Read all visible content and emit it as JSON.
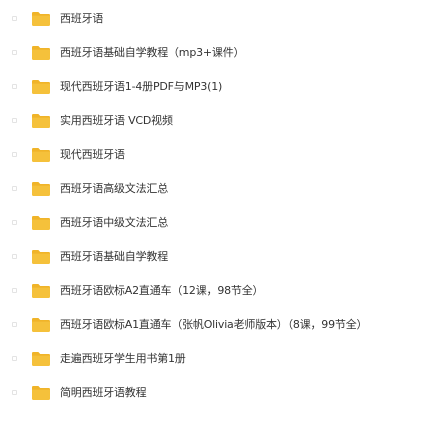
{
  "folder_color": "#f5c13b",
  "folder_tab_color": "#f0b429",
  "icon": "folder-icon",
  "items": [
    {
      "name": "西班牙语"
    },
    {
      "name": "西班牙语基础自学教程（mp3+课件）"
    },
    {
      "name": "现代西班牙语1-4册PDF与MP3(1)"
    },
    {
      "name": "实用西班牙语 VCD视频"
    },
    {
      "name": "现代西班牙语"
    },
    {
      "name": "西班牙语高级文法汇总"
    },
    {
      "name": "西班牙语中级文法汇总"
    },
    {
      "name": "西班牙语基础自学教程"
    },
    {
      "name": "西班牙语欧标A2直通车（12课，98节全）"
    },
    {
      "name": "西班牙语欧标A1直通车（张帆Olivia老师版本）（8课，99节全）"
    },
    {
      "name": "走遍西班牙学生用书第1册"
    },
    {
      "name": "简明西班牙语教程"
    }
  ]
}
